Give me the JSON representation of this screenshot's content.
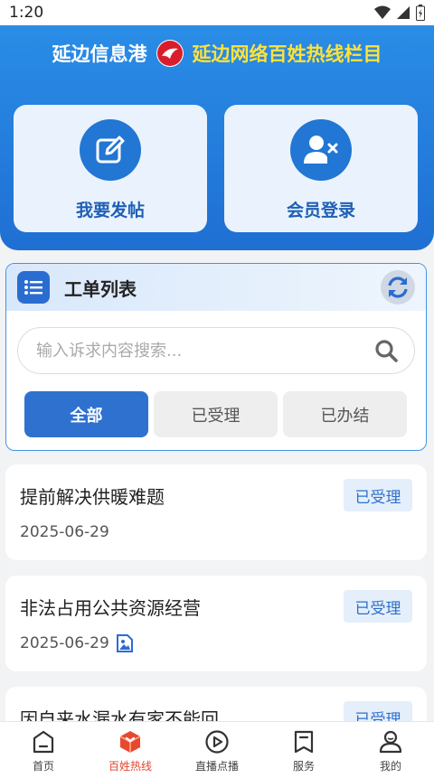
{
  "status_bar": {
    "time": "1:20"
  },
  "header": {
    "brand": "延边信息港",
    "column_title": "延边网络百姓热线栏目"
  },
  "actions": [
    {
      "label": "我要发帖",
      "icon": "edit-icon"
    },
    {
      "label": "会员登录",
      "icon": "user-login-icon"
    }
  ],
  "ticket_panel": {
    "title": "工单列表",
    "search_placeholder": "输入诉求内容搜索...",
    "tabs": [
      "全部",
      "已受理",
      "已办结"
    ],
    "active_tab": "全部"
  },
  "tickets": [
    {
      "title": "提前解决供暖难题",
      "date": "2025-06-29",
      "status": "已受理",
      "has_image": false
    },
    {
      "title": "非法占用公共资源经营",
      "date": "2025-06-29",
      "status": "已受理",
      "has_image": true
    },
    {
      "title": "因自来水漏水有家不能回",
      "date": "",
      "status": "已受理",
      "has_image": false
    }
  ],
  "bottom_nav": [
    {
      "label": "首页",
      "icon": "home-icon"
    },
    {
      "label": "百姓热线",
      "icon": "hotline-icon",
      "active": true
    },
    {
      "label": "直播点播",
      "icon": "play-icon"
    },
    {
      "label": "服务",
      "icon": "bookmark-icon"
    },
    {
      "label": "我的",
      "icon": "profile-icon"
    }
  ],
  "colors": {
    "primary": "#2276d4",
    "accent_yellow": "#ffe23a",
    "active_nav": "#e2442f"
  }
}
